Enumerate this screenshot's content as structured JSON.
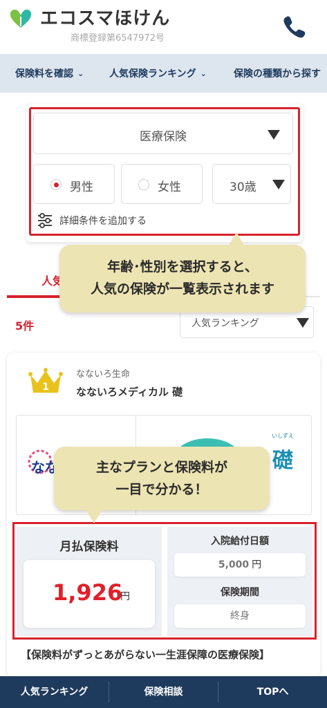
{
  "header": {
    "logo_text": "エコスマほけん",
    "trademark": "商標登録第6547972号",
    "icons": {
      "logo": "leaf-heart-logo",
      "phone": "phone-icon"
    },
    "colors": {
      "logo_green": "#7bc142",
      "logo_teal": "#2eb8a6",
      "phone": "#1e3a5c"
    }
  },
  "nav": {
    "items": [
      {
        "label": "保険料を確認"
      },
      {
        "label": "人気保険ランキング"
      },
      {
        "label": "保険の種類から探す"
      }
    ]
  },
  "search": {
    "insurance_type": "医療保険",
    "gender_male": "男性",
    "gender_female": "女性",
    "selected_gender": "男性",
    "age": "30歳",
    "detail_link": "詳細条件を追加する"
  },
  "tooltips": {
    "first_line1": "年齢･性別を選択すると、",
    "first_line2": "人気の保険が一覧表示されます",
    "second_line1": "主なプランと保険料が",
    "second_line2": "一目で分かる！"
  },
  "results": {
    "tab_label": "人気",
    "count": "5件",
    "sort": "人気ランキング"
  },
  "product": {
    "rank": "1",
    "company": "なないろ生命",
    "name": "なないろメディカル 礎",
    "image_left_text": "なな",
    "image_stamp_kanji": "礎",
    "image_stamp_small": "いしずえ",
    "premium_label": "月払保険料",
    "premium_amount": "1,926",
    "premium_unit": "円",
    "benefit_label": "入院給付日額",
    "benefit_value": "5,000",
    "benefit_unit": "円",
    "period_label": "保険期間",
    "period_value": "終身",
    "description": "【保険料がずっとあがらない一生涯保障の医療保険】"
  },
  "bottom_bar": {
    "ranking": "人気ランキング",
    "consult": "保険相談",
    "top": "TOPへ"
  },
  "colors": {
    "accent_red": "#d6222e",
    "navy": "#1e3a5c",
    "nav_bg": "#dde5ef",
    "tooltip_bg": "#ede4b3"
  }
}
